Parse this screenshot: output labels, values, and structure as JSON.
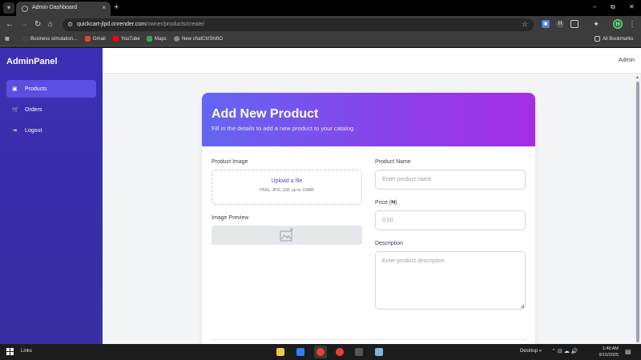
{
  "browser": {
    "tab_title": "Admin Dashboard",
    "tab_close": "×",
    "new_tab": "+",
    "window_controls": {
      "minimize": "–",
      "maximize": "⧉",
      "close": "✕"
    },
    "nav": {
      "back": "←",
      "forward": "→",
      "reload": "↻",
      "home": "⌂"
    },
    "url_host": "quickcart-jlpd.onrender.com",
    "url_path": "/owner/products/create/",
    "profile_initial": "H",
    "bookmarks": [
      {
        "label": "Business simulation...",
        "color": "#444"
      },
      {
        "label": "Gmail",
        "color": "#ea4335"
      },
      {
        "label": "YouTube",
        "color": "#ff0000"
      },
      {
        "label": "Maps",
        "color": "#34a853"
      },
      {
        "label": "New chatCtrlShiftO",
        "color": "#888"
      }
    ],
    "all_bookmarks": "All Bookmarks"
  },
  "sidebar": {
    "brand": "AdminPanel",
    "items": [
      {
        "label": "Products",
        "icon": "box-icon",
        "glyph": "▣"
      },
      {
        "label": "Orders",
        "icon": "cart-icon",
        "glyph": "🛒"
      },
      {
        "label": "Logout",
        "icon": "logout-icon",
        "glyph": "⇥"
      }
    ]
  },
  "topbar": {
    "user": "Admin"
  },
  "form": {
    "title": "Add New Product",
    "subtitle": "Fill in the details to add a new product to your catalog",
    "image_label": "Product Image",
    "upload_link": "Upload a file",
    "upload_hint": "PNG, JPG, GIF up to 10MB",
    "preview_label": "Image Preview",
    "name_label": "Product Name",
    "name_placeholder": "Enter product name",
    "price_label": "Price (₦)",
    "price_placeholder": "0.00",
    "description_label": "Description",
    "description_placeholder": "Enter product description"
  },
  "taskbar": {
    "links": "Links",
    "desktop": "Desktop",
    "chevron": "»",
    "tray_icons": "⌃⊟☁🔊",
    "time": "1:48 AM",
    "date": "9/10/2025",
    "apps": [
      {
        "name": "file-explorer-icon",
        "color": "#f2c94c"
      },
      {
        "name": "vscode-icon",
        "color": "#2f80ed"
      },
      {
        "name": "chrome-icon",
        "color": "#e94235"
      },
      {
        "name": "chrome-icon",
        "color": "#e94235"
      },
      {
        "name": "terminal-icon",
        "color": "#555"
      },
      {
        "name": "notepad-icon",
        "color": "#7fb3e0"
      }
    ]
  },
  "colors": {
    "sidebar": "#3d2fb5",
    "active_nav": "#5b4ee0",
    "header_gradient_start": "#6366f1",
    "header_gradient_end": "#a52ee3",
    "link": "#4f46e5"
  }
}
